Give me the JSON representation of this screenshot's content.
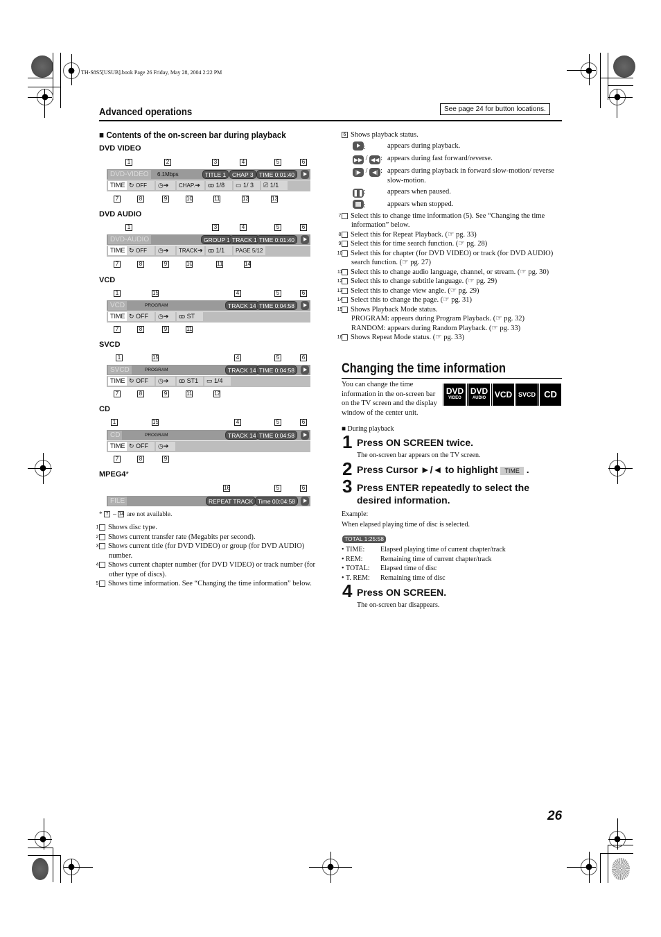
{
  "print_header": "TH-S8S5[USUB].book  Page 26  Friday, May 28, 2004  2:22 PM",
  "section_title": "Advanced operations",
  "note_box": "See page 24 for button locations.",
  "subsection_title": "Contents of the on-screen bar during playback",
  "bars": {
    "dvd_video": {
      "label": "DVD VIDEO",
      "row1": {
        "disc": "DVD-VIDEO",
        "rate": "6.1Mbps",
        "title": "TITLE  1",
        "chap": "CHAP  3",
        "time": "TIME    0:01:40"
      },
      "row2": {
        "time": "TIME",
        "repeat": "OFF",
        "chap": "CHAP.",
        "audio": "1/8",
        "subtitle": "1/  3",
        "angle": "1/1"
      },
      "top_nums": [
        "1",
        "2",
        "3",
        "4",
        "5",
        "6"
      ],
      "bottom_nums": [
        "7",
        "8",
        "9",
        "10",
        "11",
        "12",
        "13"
      ]
    },
    "dvd_audio": {
      "label": "DVD AUDIO",
      "row1": {
        "disc": "DVD-AUDIO",
        "group": "GROUP 1",
        "track": "TRACK 1",
        "time": "TIME    0:01:40"
      },
      "row2": {
        "time": "TIME",
        "repeat": "OFF",
        "track": "TRACK",
        "audio": "1/1",
        "page": "PAGE 5/12"
      },
      "top_nums": [
        "1",
        "3",
        "4",
        "5",
        "6"
      ],
      "bottom_nums": [
        "7",
        "8",
        "9",
        "10",
        "11",
        "14"
      ]
    },
    "vcd": {
      "label": "VCD",
      "row1": {
        "disc": "VCD",
        "mode": "PROGRAM",
        "track": "TRACK 14",
        "time": "TIME    0:04:58"
      },
      "row2": {
        "time": "TIME",
        "repeat": "OFF",
        "audio": "ST"
      },
      "top_nums": [
        "1",
        "15",
        "4",
        "5",
        "6"
      ],
      "bottom_nums": [
        "7",
        "8",
        "9",
        "11"
      ]
    },
    "svcd": {
      "label": "SVCD",
      "row1": {
        "disc": "SVCD",
        "mode": "PROGRAM",
        "track": "TRACK 14",
        "time": "TIME    0:04:58"
      },
      "row2": {
        "time": "TIME",
        "repeat": "OFF",
        "audio": "ST1",
        "subtitle": "1/4"
      },
      "top_nums": [
        "1",
        "15",
        "4",
        "5",
        "6"
      ],
      "bottom_nums": [
        "7",
        "8",
        "9",
        "11",
        "12"
      ]
    },
    "cd": {
      "label": "CD",
      "row1": {
        "disc": "CD",
        "mode": "PROGRAM",
        "track": "TRACK 14",
        "time": "TIME    0:04:58"
      },
      "row2": {
        "time": "TIME",
        "repeat": "OFF"
      },
      "top_nums": [
        "1",
        "15",
        "4",
        "5",
        "6"
      ],
      "bottom_nums": [
        "7",
        "8",
        "9"
      ]
    },
    "mpeg4": {
      "label": "MPEG4",
      "asterisk": "*",
      "row1": {
        "disc": "FILE",
        "repeat": "REPEAT TRACK",
        "time": "Time  00:04:58"
      },
      "top_nums": [
        "16",
        "5",
        "6"
      ]
    }
  },
  "footnote": {
    "star": "*",
    "from": "7",
    "to": "14",
    "text": "are not available."
  },
  "left_items": [
    {
      "n": "1",
      "text": "Shows disc type."
    },
    {
      "n": "2",
      "text": "Shows current transfer rate (Megabits per second)."
    },
    {
      "n": "3",
      "text": "Shows current title (for DVD VIDEO) or group (for DVD AUDIO) number."
    },
    {
      "n": "4",
      "text": "Shows current chapter number (for DVD VIDEO) or track number (for other type of discs)."
    },
    {
      "n": "5",
      "text": "Shows time information. See “Changing the time information” below."
    }
  ],
  "item6": {
    "n": "6",
    "text": "Shows playback status.",
    "statuses": [
      {
        "icon": "play",
        "text": "appears during playback."
      },
      {
        "icon": "ff-rew",
        "text": "appears during fast forward/reverse."
      },
      {
        "icon": "slow",
        "text": "appears during playback in forward slow-motion/ reverse slow-motion."
      },
      {
        "icon": "pause",
        "text": "appears when paused."
      },
      {
        "icon": "stop",
        "text": "appears when stopped."
      }
    ]
  },
  "right_items": [
    {
      "n": "7",
      "text": "Select this to change time information (5). See “Changing the time information” below."
    },
    {
      "n": "8",
      "text": "Select this for Repeat Playback. (☞ pg. 33)"
    },
    {
      "n": "9",
      "text": "Select this for time search function. (☞ pg. 28)"
    },
    {
      "n": "10",
      "text": "Select this for chapter (for DVD VIDEO) or track (for DVD AUDIO) search function. (☞ pg. 27)"
    },
    {
      "n": "11",
      "text": "Select this to change audio language, channel, or stream. (☞ pg. 30)"
    },
    {
      "n": "12",
      "text": "Select this to change subtitle language. (☞ pg. 29)"
    },
    {
      "n": "13",
      "text": "Select this to change view angle. (☞ pg. 29)"
    },
    {
      "n": "14",
      "text": "Select this to change the page. (☞ pg. 31)"
    },
    {
      "n": "15",
      "text": "Shows Playback Mode status.",
      "sub": [
        "PROGRAM: appears during Program Playback. (☞ pg. 32)",
        "RANDOM:  appears during Random Playback. (☞ pg. 33)"
      ]
    },
    {
      "n": "16",
      "text": "Shows Repeat Mode status. (☞ pg. 33)"
    }
  ],
  "time_section": {
    "title": "Changing the time information",
    "intro": "You can change the time information in the on-screen bar on the TV screen and the display window of the center unit.",
    "logos": [
      {
        "top": "DVD",
        "bottom": "VIDEO"
      },
      {
        "top": "DVD",
        "bottom": "AUDIO"
      },
      {
        "top": "VCD",
        "bottom": ""
      },
      {
        "top": "SVCD",
        "bottom": ""
      },
      {
        "top": "CD",
        "bottom": ""
      }
    ],
    "during": "During playback",
    "steps": [
      {
        "n": "1",
        "text": "Press ON SCREEN twice.",
        "desc": "The on-screen bar appears on the TV screen."
      },
      {
        "n": "2",
        "text": "Press Cursor ►/◄ to highlight",
        "chip": "TIME",
        "suffix": "."
      },
      {
        "n": "3",
        "text": "Press ENTER repeatedly to select the desired information."
      },
      {
        "n": "4",
        "text": "Press ON SCREEN.",
        "desc": "The on-screen bar disappears."
      }
    ],
    "example_label": "Example:",
    "example_text": "When elapsed playing time of disc is selected.",
    "example_chip": "TOTAL  1:25:58",
    "bullets": [
      {
        "k": "TIME:",
        "v": "Elapsed playing time of current chapter/track"
      },
      {
        "k": "REM:",
        "v": "Remaining time of current chapter/track"
      },
      {
        "k": "TOTAL:",
        "v": "Elapsed time of disc"
      },
      {
        "k": "T. REM:",
        "v": "Remaining time of disc"
      }
    ]
  },
  "page_number": "26"
}
